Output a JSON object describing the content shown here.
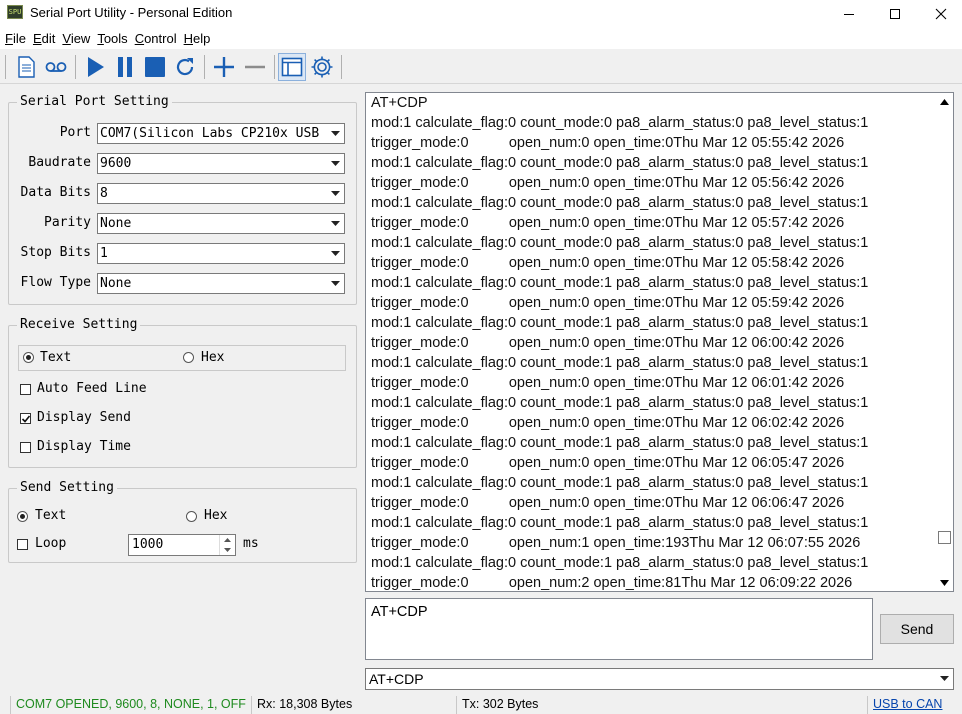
{
  "window": {
    "title": "Serial Port Utility - Personal Edition",
    "icon_text": "SPU"
  },
  "menu": [
    {
      "key": "F",
      "rest": "ile"
    },
    {
      "key": "E",
      "rest": "dit"
    },
    {
      "key": "V",
      "rest": "iew"
    },
    {
      "key": "T",
      "rest": "ools"
    },
    {
      "key": "C",
      "rest": "ontrol"
    },
    {
      "key": "H",
      "rest": "elp"
    }
  ],
  "serial_port_setting": {
    "title": "Serial Port Setting",
    "port": {
      "label": "Port",
      "value": "COM7(Silicon Labs CP210x USB"
    },
    "baudrate": {
      "label": "Baudrate",
      "value": "9600"
    },
    "data_bits": {
      "label": "Data Bits",
      "value": "8"
    },
    "parity": {
      "label": "Parity",
      "value": "None"
    },
    "stop_bits": {
      "label": "Stop Bits",
      "value": "1"
    },
    "flow_type": {
      "label": "Flow Type",
      "value": "None"
    }
  },
  "receive_setting": {
    "title": "Receive Setting",
    "text_label": "Text",
    "hex_label": "Hex",
    "auto_feed_line": "Auto Feed Line",
    "display_send": "Display Send",
    "display_time": "Display Time",
    "auto_feed_checked": false,
    "display_send_checked": true,
    "display_time_checked": false
  },
  "send_setting": {
    "title": "Send Setting",
    "text_label": "Text",
    "hex_label": "Hex",
    "loop_label": "Loop",
    "loop_value": "1000",
    "ms_label": "ms"
  },
  "receive_text": "AT+CDP\nmod:1 calculate_flag:0 count_mode:0 pa8_alarm_status:0 pa8_level_status:1\ntrigger_mode:0          open_num:0 open_time:0Thu Mar 12 05:55:42 2026\nmod:1 calculate_flag:0 count_mode:0 pa8_alarm_status:0 pa8_level_status:1\ntrigger_mode:0          open_num:0 open_time:0Thu Mar 12 05:56:42 2026\nmod:1 calculate_flag:0 count_mode:0 pa8_alarm_status:0 pa8_level_status:1\ntrigger_mode:0          open_num:0 open_time:0Thu Mar 12 05:57:42 2026\nmod:1 calculate_flag:0 count_mode:0 pa8_alarm_status:0 pa8_level_status:1\ntrigger_mode:0          open_num:0 open_time:0Thu Mar 12 05:58:42 2026\nmod:1 calculate_flag:0 count_mode:1 pa8_alarm_status:0 pa8_level_status:1\ntrigger_mode:0          open_num:0 open_time:0Thu Mar 12 05:59:42 2026\nmod:1 calculate_flag:0 count_mode:1 pa8_alarm_status:0 pa8_level_status:1\ntrigger_mode:0          open_num:0 open_time:0Thu Mar 12 06:00:42 2026\nmod:1 calculate_flag:0 count_mode:1 pa8_alarm_status:0 pa8_level_status:1\ntrigger_mode:0          open_num:0 open_time:0Thu Mar 12 06:01:42 2026\nmod:1 calculate_flag:0 count_mode:1 pa8_alarm_status:0 pa8_level_status:1\ntrigger_mode:0          open_num:0 open_time:0Thu Mar 12 06:02:42 2026\nmod:1 calculate_flag:0 count_mode:1 pa8_alarm_status:0 pa8_level_status:1\ntrigger_mode:0          open_num:0 open_time:0Thu Mar 12 06:05:47 2026\nmod:1 calculate_flag:0 count_mode:1 pa8_alarm_status:0 pa8_level_status:1\ntrigger_mode:0          open_num:0 open_time:0Thu Mar 12 06:06:47 2026\nmod:1 calculate_flag:0 count_mode:1 pa8_alarm_status:0 pa8_level_status:1\ntrigger_mode:0          open_num:1 open_time:193Thu Mar 12 06:07:55 2026\nmod:1 calculate_flag:0 count_mode:1 pa8_alarm_status:0 pa8_level_status:1\ntrigger_mode:0          open_num:2 open_time:81Thu Mar 12 06:09:22 2026",
  "send_text": "AT+CDP",
  "send_button": "Send",
  "command_combo": "AT+CDP",
  "status": {
    "connection": "COM7 OPENED, 9600, 8, NONE, 1, OFF",
    "rx": "Rx: 18,308 Bytes",
    "tx": "Tx: 302 Bytes",
    "link": "USB to CAN"
  },
  "colors": {
    "accent": "#1a5fb4",
    "status_ok": "#1e8a1e",
    "link": "#0645ad"
  }
}
